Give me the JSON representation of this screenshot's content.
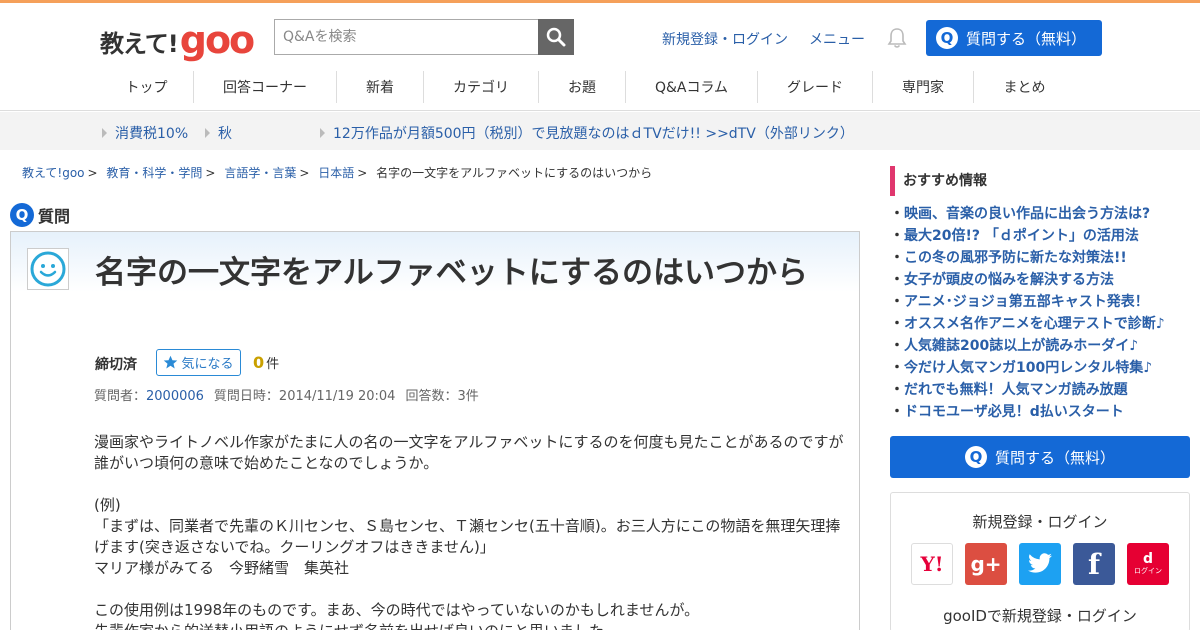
{
  "header": {
    "logo_text": "教えて!",
    "logo_brand": "goo",
    "search_placeholder": "Q&Aを検索",
    "register_login": "新規登録・ログイン",
    "menu": "メニュー",
    "ask_button": "質問する（無料）"
  },
  "nav": {
    "items": [
      {
        "label": "トップ"
      },
      {
        "label": "回答コーナー"
      },
      {
        "label": "新着"
      },
      {
        "label": "カテゴリ"
      },
      {
        "label": "お題"
      },
      {
        "label": "Q&Aコラム"
      },
      {
        "label": "グレード"
      },
      {
        "label": "専門家"
      },
      {
        "label": "まとめ"
      }
    ]
  },
  "subbar": {
    "links": [
      {
        "label": "消費税10%"
      },
      {
        "label": "秋"
      },
      {
        "label": "12万作品が月額500円（税別）で見放題なのはｄTVだけ!! >>dTV（外部リンク）"
      }
    ]
  },
  "breadcrumb": {
    "items": [
      {
        "label": "教えて!goo"
      },
      {
        "label": "教育・科学・学問"
      },
      {
        "label": "言語学・言葉"
      },
      {
        "label": "日本語"
      }
    ],
    "separator": ">",
    "current": "名字の一文字をアルファベットにするのはいつから"
  },
  "question": {
    "badge": "Q",
    "heading": "質問",
    "title": "名字の一文字をアルファベットにするのはいつから",
    "status": "締切済",
    "watch_label": "気になる",
    "watch_count": "0",
    "watch_unit": "件",
    "asker_label": "質問者：",
    "asker": "2000006",
    "date_label": "質問日時：2014/11/19 20:04",
    "answers_label": "回答数：3件",
    "body": [
      "漫画家やライトノベル作家がたまに人の名の一文字をアルファベットにするのを何度も見たことがあるのですが誰がいつ頃何の意味で始めたことなのでしょうか。",
      "(例)",
      "「まずは、同業者で先輩のＫ川センセ、Ｓ島センセ、Ｔ瀬センセ(五十音順)。お三人方にこの物語を無理矢理捧げます(突き返さないでね。クーリングオフはききません)」",
      "マリア様がみてる　今野緒雪　集英社",
      "この使用例は1998年のものです。まあ、今の時代ではやっていないのかもしれませんが。",
      "先輩作家から的送替小用語のようにせず名前を出せば良いのにと思いました。"
    ]
  },
  "sidebar": {
    "rec_title": "おすすめ情報",
    "rec_items": [
      "映画、音楽の良い作品に出会う方法は?",
      "最大20倍!? 「ｄポイント」の活用法",
      "この冬の風邪予防に新たな対策法!!",
      "女子が頭皮の悩みを解決する方法",
      "アニメ･ジョジョ第五部キャスト発表！",
      "オススメ名作アニメを心理テストで診断♪",
      "人気雑誌200誌以上が読みホーダイ♪",
      "今だけ人気マンガ100円レンタル特集♪",
      "だれでも無料！人気マンガ読み放題",
      "ドコモユーザ必見！d払いスタート"
    ],
    "ask_button": "質問する（無料）",
    "login_title": "新規登録・ログイン",
    "social": {
      "yahoo": "Y!",
      "google": "g+",
      "docomo": "d",
      "docomo_sub": "ログイン"
    },
    "login_sub": "gooIDで新規登録・ログイン"
  },
  "colors": {
    "accent": "#1469d6",
    "link": "#2a5fa8",
    "top_stripe": "#f5a05a",
    "brand_red": "#e8453c",
    "sidebar_marker": "#e0376e"
  }
}
